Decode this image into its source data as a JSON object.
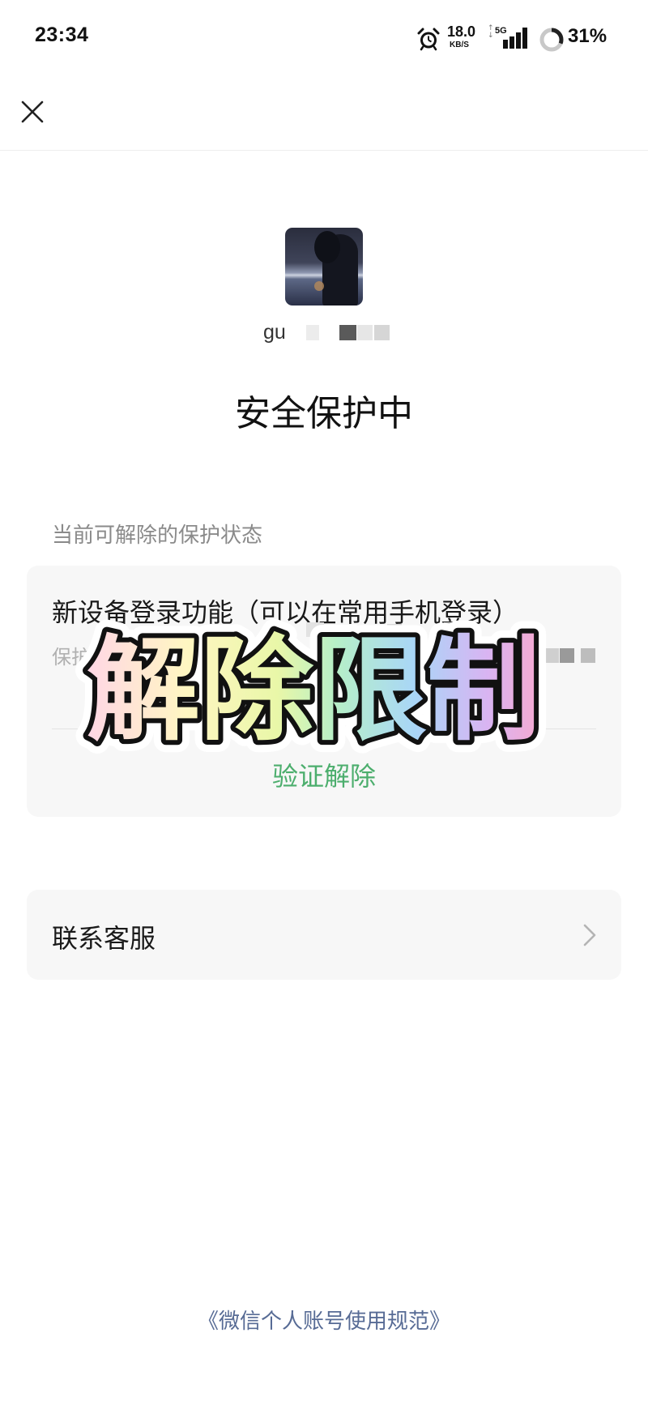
{
  "status_bar": {
    "time": "23:34",
    "alarm_icon": "alarm-clock-icon",
    "net_speed": "18.0",
    "net_unit": "KB/S",
    "network": "5G",
    "signal_icon": "cellular-signal-icon",
    "battery_text": "31%",
    "battery_level": 0.31
  },
  "header": {
    "close_icon": "close-icon"
  },
  "profile": {
    "username_visible": "gu",
    "title": "安全保护中"
  },
  "section": {
    "label": "当前可解除的保护状态"
  },
  "protection_card": {
    "item_title": "新设备登录功能（可以在常用手机登录）",
    "item_desc": "保护",
    "action_label": "验证解除"
  },
  "contact_card": {
    "label": "联系客服",
    "chevron_icon": "chevron-right-icon"
  },
  "footer": {
    "link": "《微信个人账号使用规范》"
  },
  "overlay": {
    "text": "解除限制"
  },
  "colors": {
    "accent_green": "#4cae6d",
    "link_blue": "#576b95",
    "card_background": "#f7f7f7"
  }
}
